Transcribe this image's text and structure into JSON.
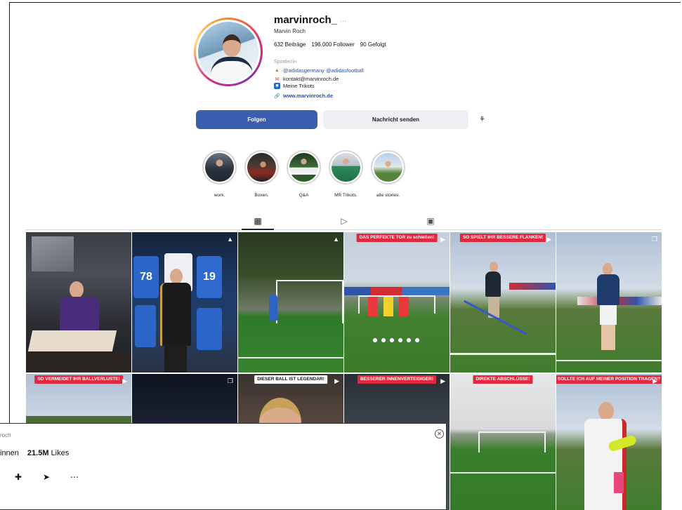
{
  "profile": {
    "username": "marvinroch_",
    "username_suffix": "...",
    "full_name": "Marvin Roch",
    "stats": {
      "posts": "632 Beiträge",
      "followers": "196.000 Follower",
      "following": "90 Gefolgt"
    },
    "category": "Sportler/in",
    "bio": [
      {
        "icon": "adidas-icon",
        "text": "@adidasgermany @adidasfootball"
      },
      {
        "icon": "mail-icon",
        "text": "kontakt@marvinroch.de"
      },
      {
        "icon": "jersey-icon",
        "text": "Meine Trikots"
      }
    ],
    "link": "www.marvinroch.de"
  },
  "actions": {
    "follow_label": "Folgen",
    "message_label": "Nachricht senden",
    "suggest_icon": "add-person-icon"
  },
  "highlights": [
    {
      "label": "work."
    },
    {
      "label": "Boxen."
    },
    {
      "label": "Q&A"
    },
    {
      "label": "MR Trikots."
    },
    {
      "label": "alte stories."
    }
  ],
  "tabs": [
    {
      "icon": "grid-icon",
      "active": true
    },
    {
      "icon": "reels-icon",
      "active": false
    },
    {
      "icon": "tagged-icon",
      "active": false
    }
  ],
  "posts": [
    {
      "banner": "",
      "badge": ""
    },
    {
      "banner": "",
      "badge": "pin-icon"
    },
    {
      "banner": "",
      "badge": "pin-icon"
    },
    {
      "banner": "DAS PERFEKTE TOR zu schießen!",
      "badge": "reel-icon"
    },
    {
      "banner": "SO SPIELT IHR BESSERE FLANKEN!",
      "badge": "reel-icon"
    },
    {
      "banner": "",
      "badge": "carousel-icon"
    },
    {
      "banner": "SO VERMEIDET IHR BALLVERLUSTE!",
      "badge": "reel-icon"
    },
    {
      "banner": "",
      "badge": "carousel-icon"
    },
    {
      "banner": "DIESER BALL IST LEGENDÄR!",
      "badge": "reel-icon"
    },
    {
      "banner": "BESSERER INNENVERTEIDIGER!",
      "badge": "reel-icon"
    },
    {
      "banner": "DIREKTE ABSCHLÜSSE!",
      "badge": ""
    },
    {
      "banner": "SOLLTE ICH AUF MEINER POSITION TRAGEN?",
      "badge": "reel-icon"
    }
  ],
  "popup": {
    "name": "roch",
    "followers_suffix": "innen",
    "likes": "21.5M",
    "likes_label": "Likes",
    "icons": [
      "add-person-icon",
      "share-icon",
      "more-icon"
    ]
  },
  "colors": {
    "follow_button": "#3b5eb0",
    "banner_red": "#e0283f",
    "link_blue": "#2a4ea8"
  }
}
